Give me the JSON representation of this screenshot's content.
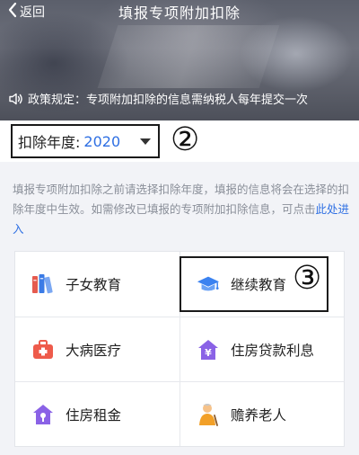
{
  "header": {
    "back_label": "返回",
    "title": "填报专项附加扣除",
    "notice": "政策规定：专项附加扣除的信息需纳税人每年提交一次"
  },
  "year_selector": {
    "label": "扣除年度:",
    "value": "2020",
    "annotation": "②"
  },
  "info": {
    "text": "填报专项附加扣除之前请选择扣除年度，填报的信息将会在选择的扣除年度中生效。如需修改已填报的专项附加扣除信息，可点击",
    "link": "此处进入"
  },
  "items": [
    {
      "label": "子女教育",
      "icon": "books-icon"
    },
    {
      "label": "继续教育",
      "icon": "graduation-cap-icon"
    },
    {
      "label": "大病医疗",
      "icon": "medical-kit-icon"
    },
    {
      "label": "住房贷款利息",
      "icon": "house-yen-icon"
    },
    {
      "label": "住房租金",
      "icon": "house-key-icon"
    },
    {
      "label": "赡养老人",
      "icon": "elderly-person-icon"
    }
  ],
  "highlight_annotation": "③",
  "colors": {
    "accent": "#2e6fe3",
    "info_text": "#8a8f99",
    "books_red": "#e55b4f",
    "books_blue": "#3b7be6",
    "cap_blue": "#3b82f0",
    "medical_red": "#ee5b4b",
    "purple": "#8a62e6",
    "elder_orange": "#f2a028"
  }
}
